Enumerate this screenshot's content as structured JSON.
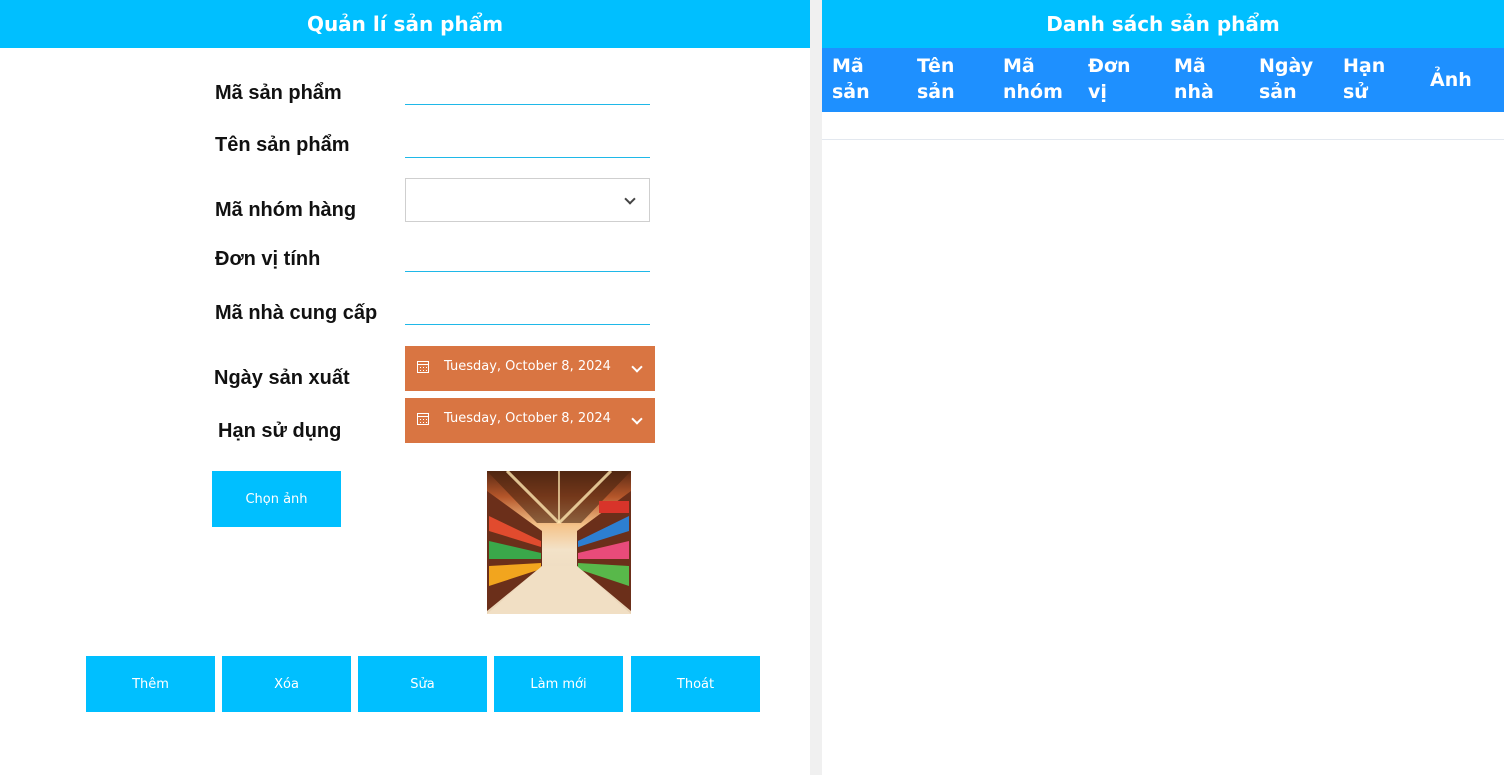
{
  "left": {
    "title": "Quản lí sản phẩm",
    "fields": {
      "product_id": {
        "label": "Mã sản phẩm",
        "value": ""
      },
      "product_name": {
        "label": "Tên sản phẩm",
        "value": ""
      },
      "group_id": {
        "label": "Mã nhóm hàng",
        "selected": ""
      },
      "unit": {
        "label": "Đơn vị tính",
        "value": ""
      },
      "supplier_id": {
        "label": "Mã nhà cung cấp",
        "value": ""
      },
      "manufacture_date": {
        "label": "Ngày sản xuất",
        "value": "Tuesday, October 8, 2024"
      },
      "expiry_date": {
        "label": "Hạn sử dụng",
        "value": "Tuesday, October 8, 2024"
      }
    },
    "choose_image_label": "Chọn ảnh",
    "buttons": {
      "add": "Thêm",
      "delete": "Xóa",
      "edit": "Sửa",
      "refresh": "Làm mới",
      "exit": "Thoát"
    }
  },
  "right": {
    "title": "Danh sách sản phẩm",
    "columns": [
      {
        "line1": "Mã",
        "line2": "sản"
      },
      {
        "line1": "Tên",
        "line2": "sản"
      },
      {
        "line1": "Mã",
        "line2": "nhóm"
      },
      {
        "line1": "Đơn",
        "line2": "vị"
      },
      {
        "line1": "Mã",
        "line2": "nhà"
      },
      {
        "line1": "Ngày",
        "line2": "sản"
      },
      {
        "line1": "Hạn",
        "line2": "sử"
      },
      {
        "line1": "Ảnh",
        "line2": ""
      }
    ]
  },
  "colors": {
    "header": "#00bfff",
    "table_header": "#1e90ff",
    "date_picker": "#d97542",
    "input_underline": "#1fb8e8"
  },
  "icons": {
    "calendar": "calendar-icon",
    "dropdown": "chevron-down-icon"
  }
}
